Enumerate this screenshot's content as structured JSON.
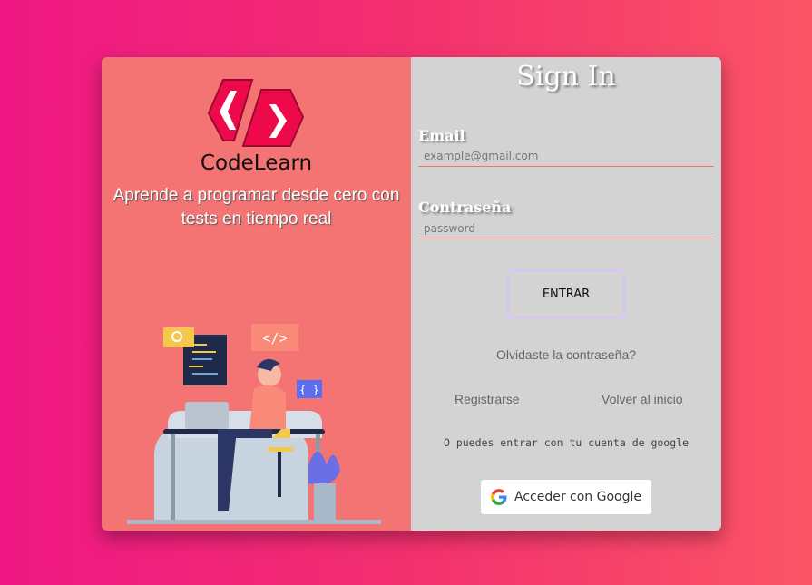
{
  "brand": {
    "name": "CodeLearn",
    "tagline": "Aprende a programar desde cero con tests en tiempo real"
  },
  "illustration": {
    "code_tag": "</>",
    "braces": "{ }"
  },
  "form": {
    "title": "Sign In",
    "email_label": "Email",
    "email_placeholder": "example@gmail.com",
    "email_value": "",
    "password_label": "Contraseña",
    "password_placeholder": "password",
    "password_value": "",
    "submit": "ENTRAR",
    "forgot": "Olvidaste la contraseña?",
    "register": "Registrarse",
    "back": "Volver al inicio",
    "alt_text": "O puedes entrar con tu cuenta de google",
    "google_button": "Acceder con Google"
  },
  "colors": {
    "left_panel": "#f37472",
    "right_panel": "#d3d3d3",
    "logo": "#ee0a4a",
    "accent_line": "#f37472"
  }
}
